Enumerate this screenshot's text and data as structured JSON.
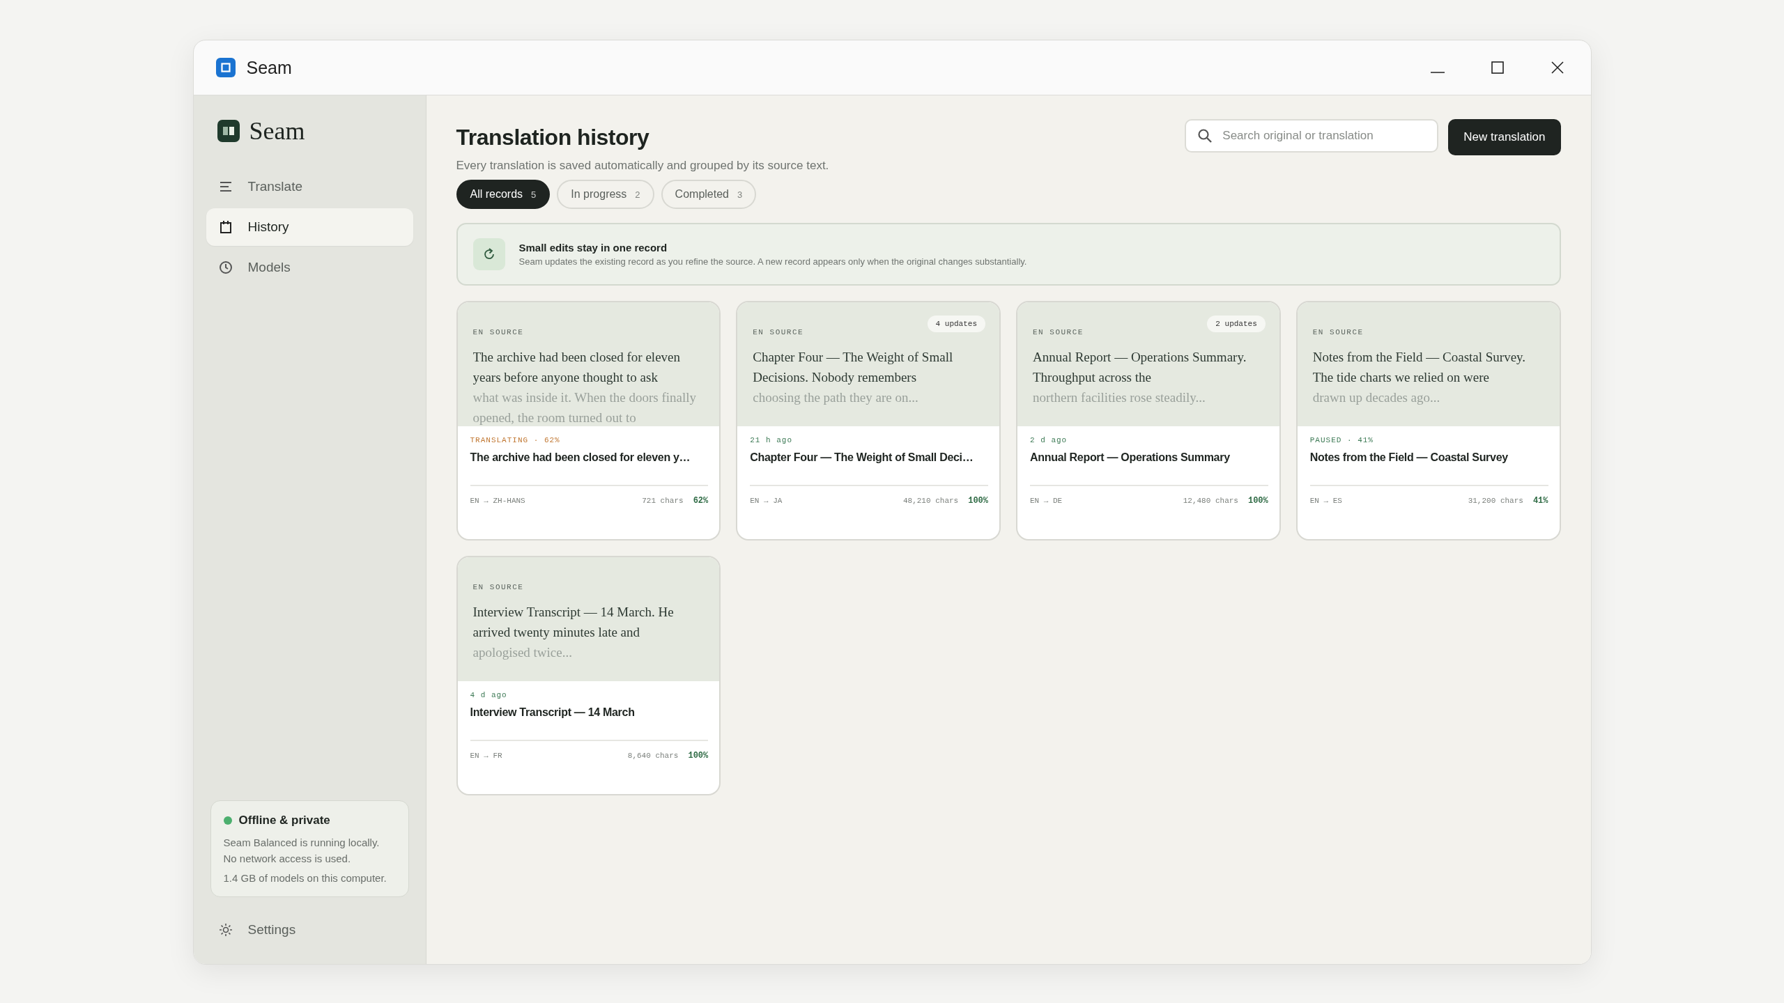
{
  "window": {
    "title": "Seam"
  },
  "sidebar": {
    "brand": "Seam",
    "items": [
      {
        "label": "Translate",
        "selected": false
      },
      {
        "label": "History",
        "selected": true
      },
      {
        "label": "Models",
        "selected": false
      }
    ],
    "status_card": {
      "title": "Offline & private",
      "color": "#4caf6e",
      "lines": [
        "Seam Balanced is running locally.",
        "No network access is used."
      ],
      "note": "1.4 GB of models on this computer."
    },
    "settings": {
      "label": "Settings"
    }
  },
  "header": {
    "title": "Translation history",
    "subtitle": "Every translation is saved automatically and grouped by its source text.",
    "search": {
      "placeholder": "Search original or translation"
    },
    "new_button": "New translation"
  },
  "filters": [
    {
      "label": "All records",
      "count": "5",
      "selected": true
    },
    {
      "label": "In progress",
      "count": "2",
      "selected": false
    },
    {
      "label": "Completed",
      "count": "3",
      "selected": false
    }
  ],
  "banner": {
    "title": "Small edits stay in one record",
    "text": "Seam updates the existing record as you refine the source. A new record appears only when the original changes substantially."
  },
  "cards": [
    {
      "source_label": "EN SOURCE",
      "source": "The archive had been closed for eleven years before anyone thought to ask",
      "source_faded": "what was inside it. When the doors finally opened, the room turned out to",
      "status": "TRANSLATING · 62%",
      "kind": "translating",
      "title": "The archive had been closed for eleven y…",
      "langs": "EN → ZH-HANS",
      "chars": "721 chars",
      "percent": "62%"
    },
    {
      "source_label": "EN SOURCE",
      "badge": "4 updates",
      "source": "Chapter Four — The Weight of Small Decisions. Nobody remembers",
      "source_faded": "choosing the path they are on...",
      "status": "21 h ago",
      "kind": "time",
      "title": "Chapter Four — The Weight of Small Deci…",
      "langs": "EN → JA",
      "chars": "48,210 chars",
      "percent": "100%"
    },
    {
      "source_label": "EN SOURCE",
      "badge": "2 updates",
      "source": "Annual Report — Operations Summary. Throughput across the",
      "source_faded": "northern facilities rose steadily...",
      "status": "2 d ago",
      "kind": "time",
      "title": "Annual Report — Operations Summary",
      "langs": "EN → DE",
      "chars": "12,480 chars",
      "percent": "100%"
    },
    {
      "source_label": "EN SOURCE",
      "source": "Notes from the Field — Coastal Survey. The tide charts we relied on were",
      "source_faded": "drawn up decades ago...",
      "status": "PAUSED · 41%",
      "kind": "paused",
      "title": "Notes from the Field — Coastal Survey",
      "langs": "EN → ES",
      "chars": "31,200 chars",
      "percent": "41%"
    },
    {
      "source_label": "EN SOURCE",
      "source": "Interview Transcript — 14 March. He arrived twenty minutes late and",
      "source_faded": "apologised twice...",
      "status": "4 d ago",
      "kind": "time",
      "title": "Interview Transcript — 14 March",
      "langs": "EN → FR",
      "chars": "8,640 chars",
      "percent": "100%"
    }
  ]
}
